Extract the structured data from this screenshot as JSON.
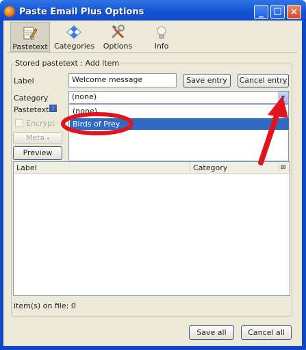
{
  "window": {
    "title": "Paste Email Plus Options",
    "controls": [
      "minimize-button",
      "maximize-button",
      "close-button"
    ]
  },
  "toolbar": {
    "tabs": [
      {
        "label": "Pastetext",
        "icon": "notepad-pencil-icon",
        "active": true
      },
      {
        "label": "Categories",
        "icon": "categories-icon",
        "active": false
      },
      {
        "label": "Options",
        "icon": "tools-icon",
        "active": false
      },
      {
        "label": "Info",
        "icon": "lightbulb-icon",
        "active": false
      }
    ]
  },
  "form": {
    "group_title": "Stored pastetext : Add item",
    "label_caption": "Label",
    "label_value": "Welcome message",
    "category_caption": "Category",
    "category_value": "(none)",
    "pastetext_caption": "Pastetext",
    "encrypt_label": "Encrypt",
    "meta_label": "Meta",
    "preview_label": "Preview",
    "save_entry_label": "Save entry",
    "cancel_entry_label": "Cancel entry"
  },
  "category_dropdown": {
    "options": [
      "(none)",
      "Birds of Prey"
    ],
    "selected": "Birds of Prey"
  },
  "table": {
    "columns": [
      "Label",
      "Category"
    ],
    "rows": []
  },
  "status": {
    "items_on_file": "item(s) on file: 0"
  },
  "footer": {
    "save_all_label": "Save all",
    "cancel_all_label": "Cancel all"
  },
  "colors": {
    "titlebar": "#1657d6",
    "client_bg": "#ece9d8",
    "selection": "#316ac5",
    "annotation_red": "#e0141e"
  }
}
